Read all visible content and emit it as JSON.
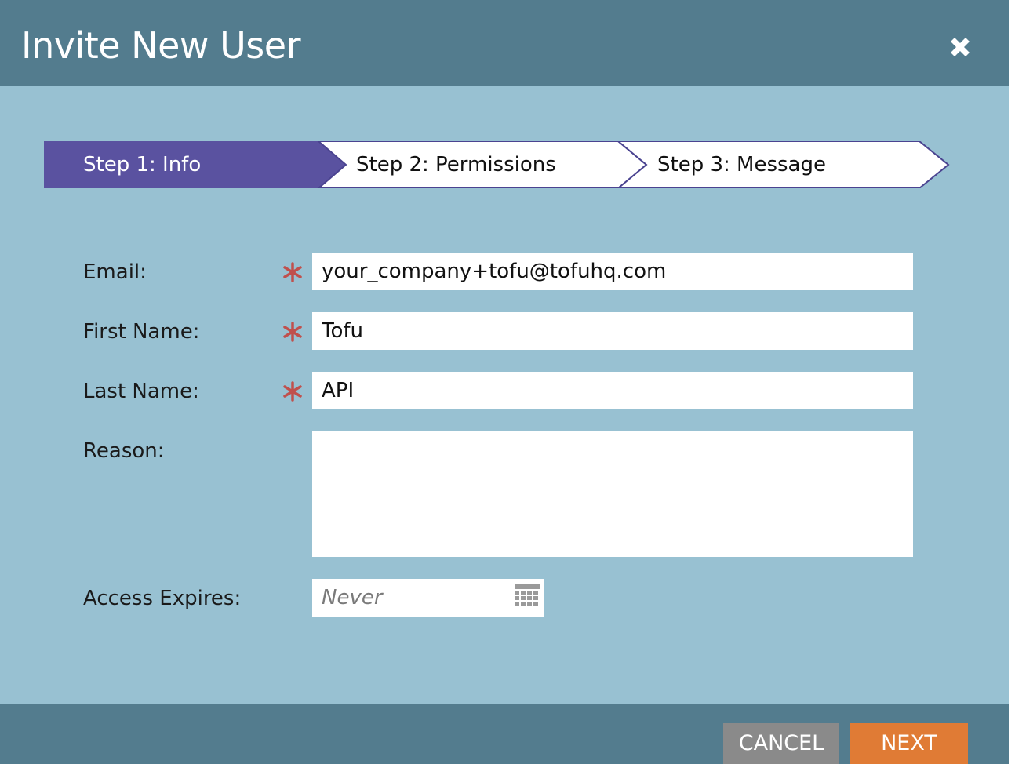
{
  "dialog": {
    "title": "Invite New User"
  },
  "steps": [
    {
      "label": "Step 1: Info",
      "active": true
    },
    {
      "label": "Step 2: Permissions",
      "active": false
    },
    {
      "label": "Step 3: Message",
      "active": false
    }
  ],
  "form": {
    "email": {
      "label": "Email:",
      "value": "your_company+tofu@tofuhq.com",
      "required": true
    },
    "first_name": {
      "label": "First Name:",
      "value": "Tofu",
      "required": true
    },
    "last_name": {
      "label": "Last Name:",
      "value": "API",
      "required": true
    },
    "reason": {
      "label": "Reason:",
      "value": ""
    },
    "access_expires": {
      "label": "Access Expires:",
      "placeholder": "Never"
    }
  },
  "footer": {
    "cancel_label": "CANCEL",
    "next_label": "NEXT"
  },
  "icons": {
    "close": "close-icon",
    "required": "asterisk-icon",
    "calendar": "calendar-icon"
  },
  "colors": {
    "header": "#537c8e",
    "body": "#98c1d2",
    "active_step": "#5a52a0",
    "step_border": "#4a4390",
    "required_star": "#c0504d",
    "cancel_button": "#8a8a8a",
    "next_button": "#e07b35"
  }
}
